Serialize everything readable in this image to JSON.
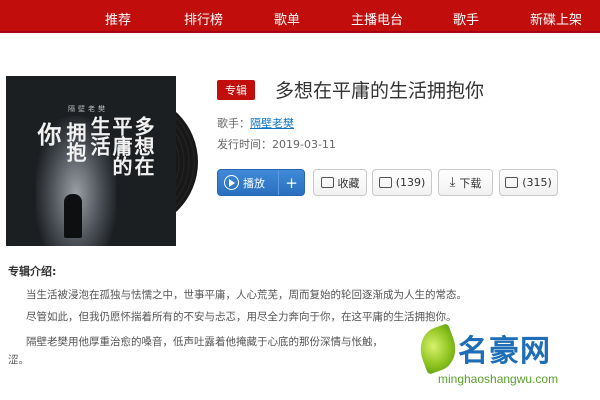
{
  "nav": {
    "items": [
      "推荐",
      "排行榜",
      "歌单",
      "主播电台",
      "歌手",
      "新碟上架"
    ]
  },
  "album": {
    "tag": "专辑",
    "title": "多想在平庸的生活拥抱你",
    "artist_label": "歌手：",
    "artist": "隔壁老樊",
    "release_label": "发行时间：",
    "release_date": "2019-03-11",
    "cover": {
      "artist_text": "隔壁老樊",
      "lines": [
        "你",
        "拥抱",
        "生活",
        "平庸的",
        "多想在"
      ]
    }
  },
  "actions": {
    "play": "播放",
    "add": "+",
    "collect": "收藏",
    "share": "(139)",
    "download": "下载",
    "comment": "(315)"
  },
  "intro": {
    "title": "专辑介绍:",
    "paragraphs": [
      "当生活被浸泡在孤独与怯懦之中，世事平庸，人心荒芜，周而复始的轮回逐渐成为人生的常态。",
      "尽管如此，但我仍愿怀揣着所有的不安与忐忑，用尽全力奔向于你，在这平庸的生活拥抱你。",
      "隔壁老樊用他厚重治愈的嗓音，低声吐露着他掩藏于心底的那份深情与怅触，",
      "涩。"
    ]
  },
  "watermark": {
    "name": "名豪网",
    "url": "minghaoshangwu.com"
  },
  "colors": {
    "brand_red": "#c10d0c",
    "play_blue": "#2b6fbf",
    "link_blue": "#0c73c2"
  }
}
